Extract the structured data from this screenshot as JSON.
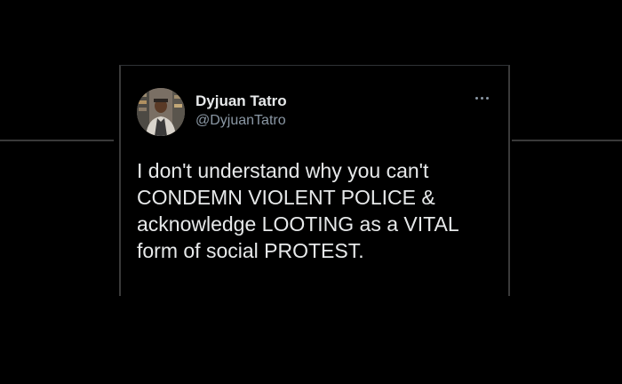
{
  "tweet": {
    "author": {
      "display_name": "Dyjuan Tatro",
      "handle": "@DyjuanTatro",
      "avatar_icon": "profile-photo"
    },
    "more_icon": "ellipsis-icon",
    "text_lines": [
      "I don't understand why you can't",
      "CONDEMN VIOLENT POLICE &",
      "acknowledge LOOTING as a VITAL",
      "form of social PROTEST."
    ]
  },
  "colors": {
    "background": "#000000",
    "text_primary": "#e7e9ea",
    "text_secondary": "#8b98a5",
    "frame_lines": "#3a3a3a"
  }
}
